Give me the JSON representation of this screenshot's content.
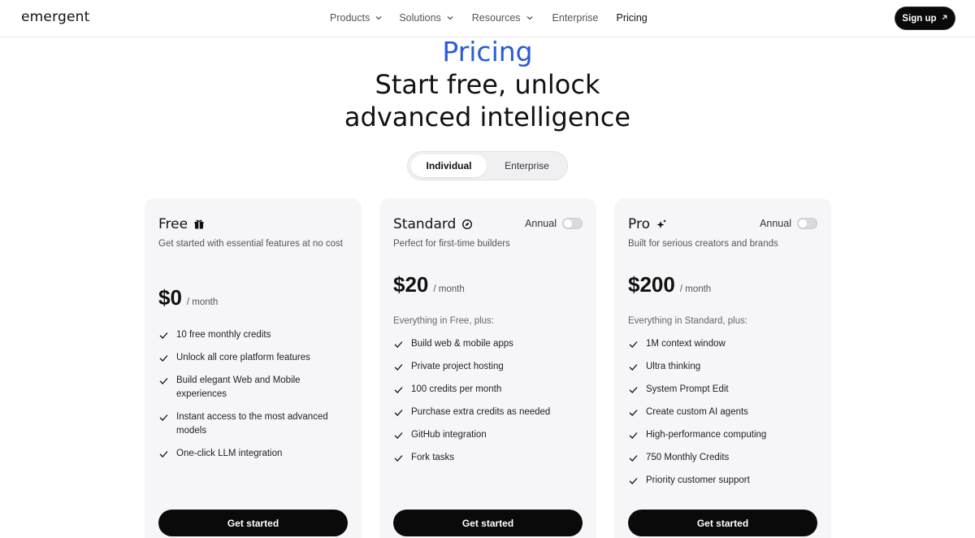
{
  "brand": {
    "logo_text": "emergent"
  },
  "nav": {
    "items": [
      {
        "label": "Products",
        "has_menu": true
      },
      {
        "label": "Solutions",
        "has_menu": true
      },
      {
        "label": "Resources",
        "has_menu": true
      },
      {
        "label": "Enterprise",
        "has_menu": false
      },
      {
        "label": "Pricing",
        "has_menu": false
      }
    ],
    "signup_label": "Sign up",
    "signup_icon": "arrow-up-right-icon"
  },
  "hero": {
    "eyebrow": "Pricing",
    "headline_line1": "Start free, unlock",
    "headline_line2": "advanced intelligence"
  },
  "plan_toggle": {
    "selected": "Individual",
    "options": [
      "Individual",
      "Enterprise"
    ]
  },
  "plans": [
    {
      "name": "Free",
      "icon": "gift-icon",
      "description": "Get started with essential features at no cost",
      "price": "$0",
      "period": "/ month",
      "features_intro": "",
      "features": [
        "10 free monthly credits",
        "Unlock all core platform features",
        "Build elegant Web and Mobile experiences",
        "Instant access to the most advanced models",
        "One-click LLM integration"
      ],
      "cta": "Get started"
    },
    {
      "name": "Standard",
      "icon": "compass-icon",
      "annual_label": "Annual",
      "annual_enabled": false,
      "description": "Perfect for first-time builders",
      "price": "$20",
      "period": "/ month",
      "features_intro": "Everything in Free, plus:",
      "features": [
        "Build web & mobile apps",
        "Private project hosting",
        "100 credits per month",
        "Purchase extra credits as needed",
        "GitHub integration",
        "Fork tasks"
      ],
      "cta": "Get started"
    },
    {
      "name": "Pro",
      "icon": "sparkle-icon",
      "annual_label": "Annual",
      "annual_enabled": false,
      "description": "Built for serious creators and brands",
      "price": "$200",
      "period": "/ month",
      "features_intro": "Everything in Standard, plus:",
      "features": [
        "1M context window",
        "Ultra thinking",
        "System Prompt Edit",
        "Create custom AI agents",
        "High-performance computing",
        "750 Monthly Credits",
        "Priority customer support"
      ],
      "cta": "Get started"
    }
  ],
  "colors": {
    "accent_blue": "#2a5bd7",
    "cta_black": "#0a0a0a",
    "card_bg": "#f6f6f8"
  }
}
